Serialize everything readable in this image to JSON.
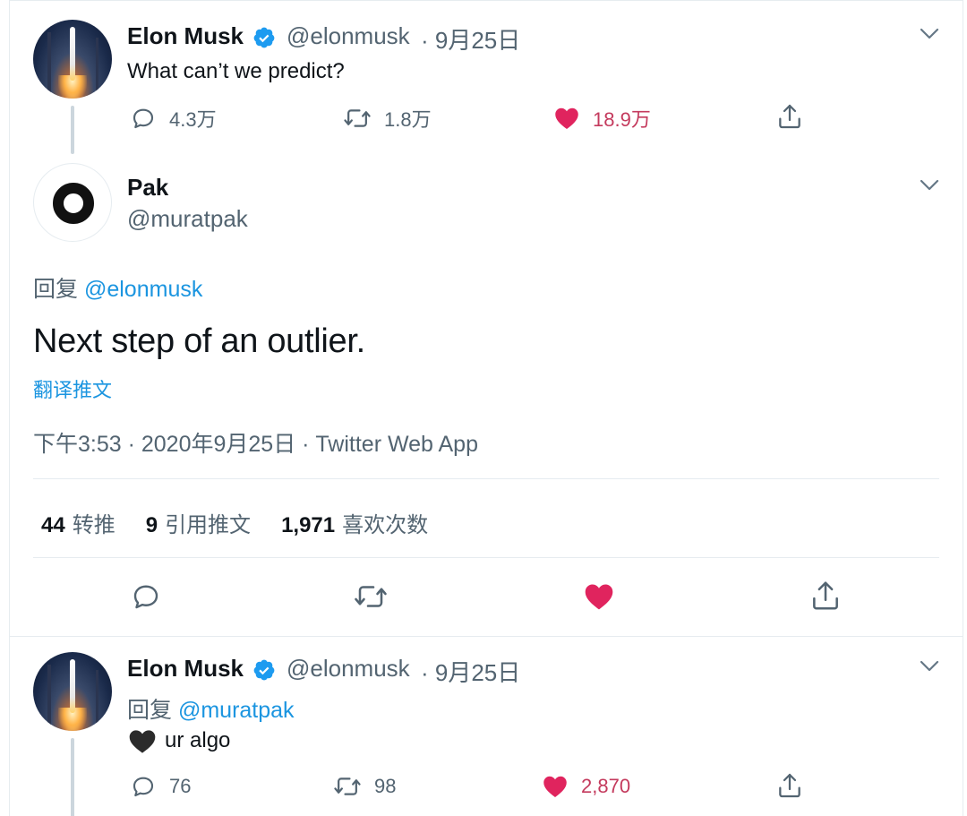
{
  "tweet1": {
    "name": "Elon Musk",
    "handle": "@elonmusk",
    "date": "· 9月25日",
    "text": "What can’t we predict?",
    "replies": "4.3万",
    "retweets": "1.8万",
    "likes": "18.9万"
  },
  "main_tweet": {
    "name": "Pak",
    "handle": "@muratpak",
    "reply_prefix": "回复",
    "reply_to": "@elonmusk",
    "text": "Next step of an outlier.",
    "translate": "翻译推文",
    "meta": "下午3:53 · 2020年9月25日 · Twitter Web App",
    "stats": {
      "retweets_num": "44",
      "retweets_label": "转推",
      "quotes_num": "9",
      "quotes_label": "引用推文",
      "likes_num": "1,971",
      "likes_label": "喜欢次数"
    }
  },
  "tweet3": {
    "name": "Elon Musk",
    "handle": "@elonmusk",
    "date": "· 9月25日",
    "reply_prefix": "回复",
    "reply_to": "@muratpak",
    "text": "ur algo",
    "replies": "76",
    "retweets": "98",
    "likes": "2,870"
  },
  "colors": {
    "accent": "#1b95e0",
    "like": "#e0245e",
    "like_count": "#c43a5d",
    "muted": "#536471",
    "border": "#e6ecf0"
  },
  "icons": [
    "verified-badge-icon",
    "chevron-down-icon",
    "reply-icon",
    "retweet-icon",
    "heart-icon",
    "share-icon",
    "black-heart-emoji"
  ]
}
